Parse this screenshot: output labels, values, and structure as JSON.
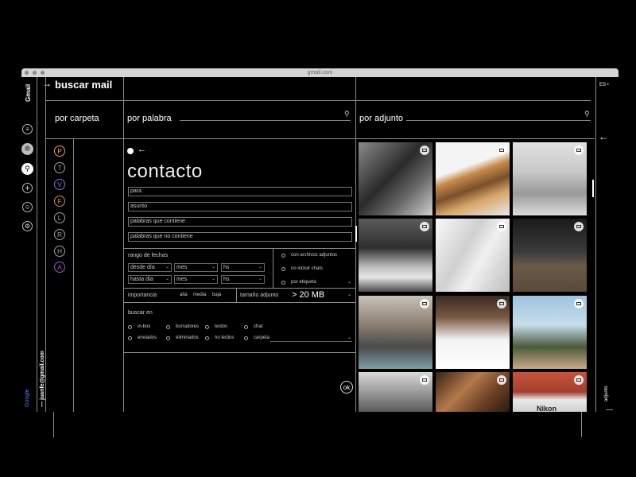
{
  "browser": {
    "url": "gmail.com"
  },
  "app": {
    "brand": "Gmail",
    "title": "buscar mail",
    "lang": "ES",
    "account": "juanfe@gmail.com",
    "google": "Google",
    "adjunto_label": "adjunto"
  },
  "tabs": {
    "carpeta": "por carpeta",
    "palabra": "por palabra",
    "adjunto": "por adjunto"
  },
  "folders": [
    {
      "letter": "P",
      "color": "#e8a15a"
    },
    {
      "letter": "T",
      "color": "#9aa0a6"
    },
    {
      "letter": "V",
      "color": "#8a6ad8"
    },
    {
      "letter": "F",
      "color": "#d88a3a"
    },
    {
      "letter": "L",
      "color": "#9aa0a6"
    },
    {
      "letter": "R",
      "color": "#9aa0a6"
    },
    {
      "letter": "H",
      "color": "#9aa0a6"
    },
    {
      "letter": "A",
      "color": "#b04ad0"
    }
  ],
  "form": {
    "heading": "contacto",
    "para": "para",
    "asunto": "asunto",
    "contiene": "palabras que contiene",
    "no_contiene": "palabras que no contiene",
    "rango": "rango de fechas",
    "desde": "desde día",
    "hasta": "hasta día",
    "mes": "mes",
    "hs": "hs",
    "con_adjuntos": "con archivos adjuntos",
    "no_chats": "no incluir chats",
    "etiqueta": "por etiqueta",
    "importancia": "importancia",
    "alta": "alta",
    "media": "media",
    "baja": "baja",
    "tamano": "tamaño adjunto",
    "tamano_val": "> 20 MB",
    "buscar_en": "buscar en",
    "inbox": "in-box",
    "borradores": "borradores",
    "leidos": "leídos",
    "chat": "chat",
    "enviados": "enviados",
    "eliminados": "eliminados",
    "no_leidos": "no leídos",
    "carpeta": "carpeta",
    "ok": "ok"
  },
  "photos": {
    "nikon": "Nikon"
  }
}
